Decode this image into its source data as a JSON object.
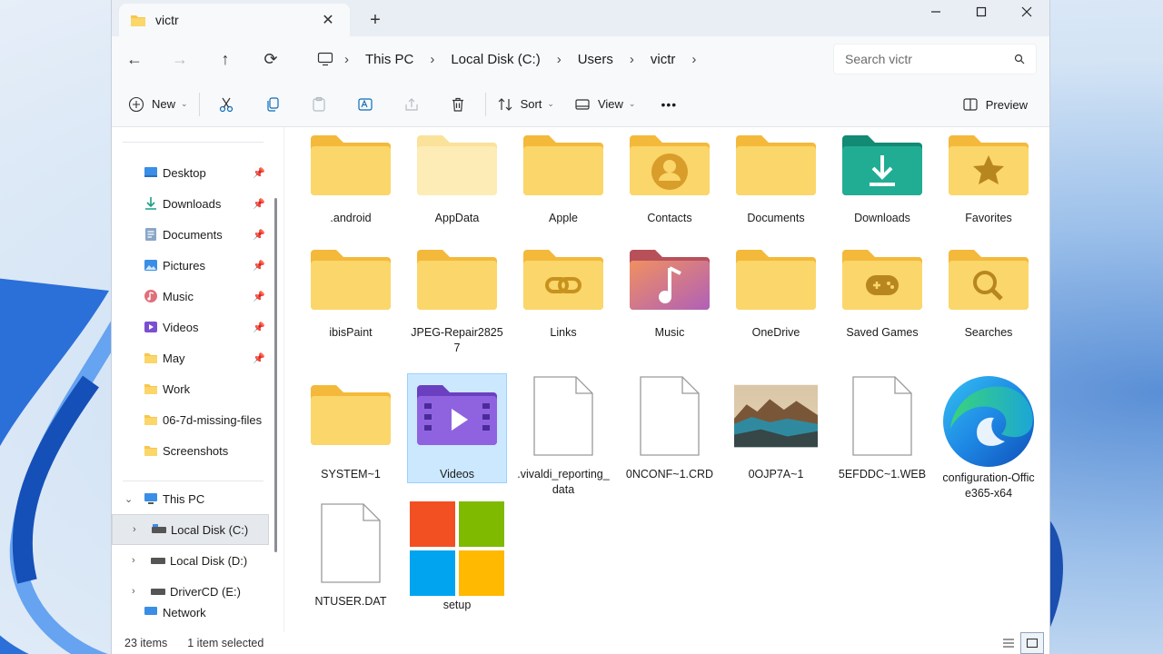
{
  "window": {
    "tab_title": "victr",
    "close_tab": "✕",
    "new_tab": "+",
    "minimize": "—",
    "maximize": "☐",
    "close": "✕"
  },
  "nav": {
    "back": "←",
    "forward": "→",
    "up": "↑",
    "refresh": "⟳"
  },
  "breadcrumb": [
    "This PC",
    "Local Disk (C:)",
    "Users",
    "victr"
  ],
  "search": {
    "placeholder": "Search victr"
  },
  "toolbar": {
    "new_label": "New",
    "sort_label": "Sort",
    "view_label": "View",
    "more_label": "•••",
    "preview_label": "Preview"
  },
  "sidebar": {
    "quick_access": [
      {
        "label": "Desktop",
        "icon": "desktop-icon",
        "pinned": true
      },
      {
        "label": "Downloads",
        "icon": "downloads-icon",
        "pinned": true
      },
      {
        "label": "Documents",
        "icon": "documents-icon",
        "pinned": true
      },
      {
        "label": "Pictures",
        "icon": "pictures-icon",
        "pinned": true
      },
      {
        "label": "Music",
        "icon": "music-icon",
        "pinned": true
      },
      {
        "label": "Videos",
        "icon": "videos-icon",
        "pinned": true
      },
      {
        "label": "May",
        "icon": "folder-icon",
        "pinned": true
      },
      {
        "label": "Work",
        "icon": "folder-icon",
        "pinned": false
      },
      {
        "label": "06-7d-missing-files",
        "icon": "folder-icon",
        "pinned": false
      },
      {
        "label": "Screenshots",
        "icon": "folder-icon",
        "pinned": false
      }
    ],
    "this_pc": "This PC",
    "drives": [
      "Local Disk (C:)",
      "Local Disk (D:)",
      "DriverCD (E:)"
    ],
    "network_partial": "Network"
  },
  "items": [
    {
      "label": ".android",
      "icon": "folder-doc-icon"
    },
    {
      "label": "AppData",
      "icon": "folder-light-icon"
    },
    {
      "label": "Apple",
      "icon": "folder-icon"
    },
    {
      "label": "Contacts",
      "icon": "contacts-folder-icon"
    },
    {
      "label": "Documents",
      "icon": "folder-icon"
    },
    {
      "label": "Downloads",
      "icon": "downloads-folder-icon"
    },
    {
      "label": "Favorites",
      "icon": "favorites-folder-icon"
    },
    {
      "label": "ibisPaint",
      "icon": "folder-doc-icon"
    },
    {
      "label": "JPEG-Repair28257",
      "icon": "folder-image-icon"
    },
    {
      "label": "Links",
      "icon": "links-folder-icon"
    },
    {
      "label": "Music",
      "icon": "music-folder-icon"
    },
    {
      "label": "OneDrive",
      "icon": "folder-icon"
    },
    {
      "label": "Saved Games",
      "icon": "games-folder-icon"
    },
    {
      "label": "Searches",
      "icon": "searches-folder-icon"
    },
    {
      "label": "SYSTEM~1",
      "icon": "folder-doc-icon"
    },
    {
      "label": "Videos",
      "icon": "videos-folder-icon"
    },
    {
      "label": ".vivaldi_reporting_data",
      "icon": "file-icon"
    },
    {
      "label": "0NCONF~1.CRD",
      "icon": "file-icon"
    },
    {
      "label": "0OJP7A~1",
      "icon": "image-thumbnail-icon"
    },
    {
      "label": "5EFDDC~1.WEB",
      "icon": "file-icon"
    },
    {
      "label": "configuration-Office365-x64",
      "icon": "edge-icon"
    },
    {
      "label": "NTUSER.DAT",
      "icon": "file-icon"
    },
    {
      "label": "setup",
      "icon": "windows-logo-icon"
    }
  ],
  "status": {
    "count": "23 items",
    "selected": "1 item selected"
  },
  "colors": {
    "folder": "#f8c64a",
    "folder_light": "#fce8a8",
    "downloads_folder": "#1a9e84",
    "music_folder": "#d8646e",
    "videos_folder": "#7a4fd0",
    "selection": "#cce8ff"
  }
}
